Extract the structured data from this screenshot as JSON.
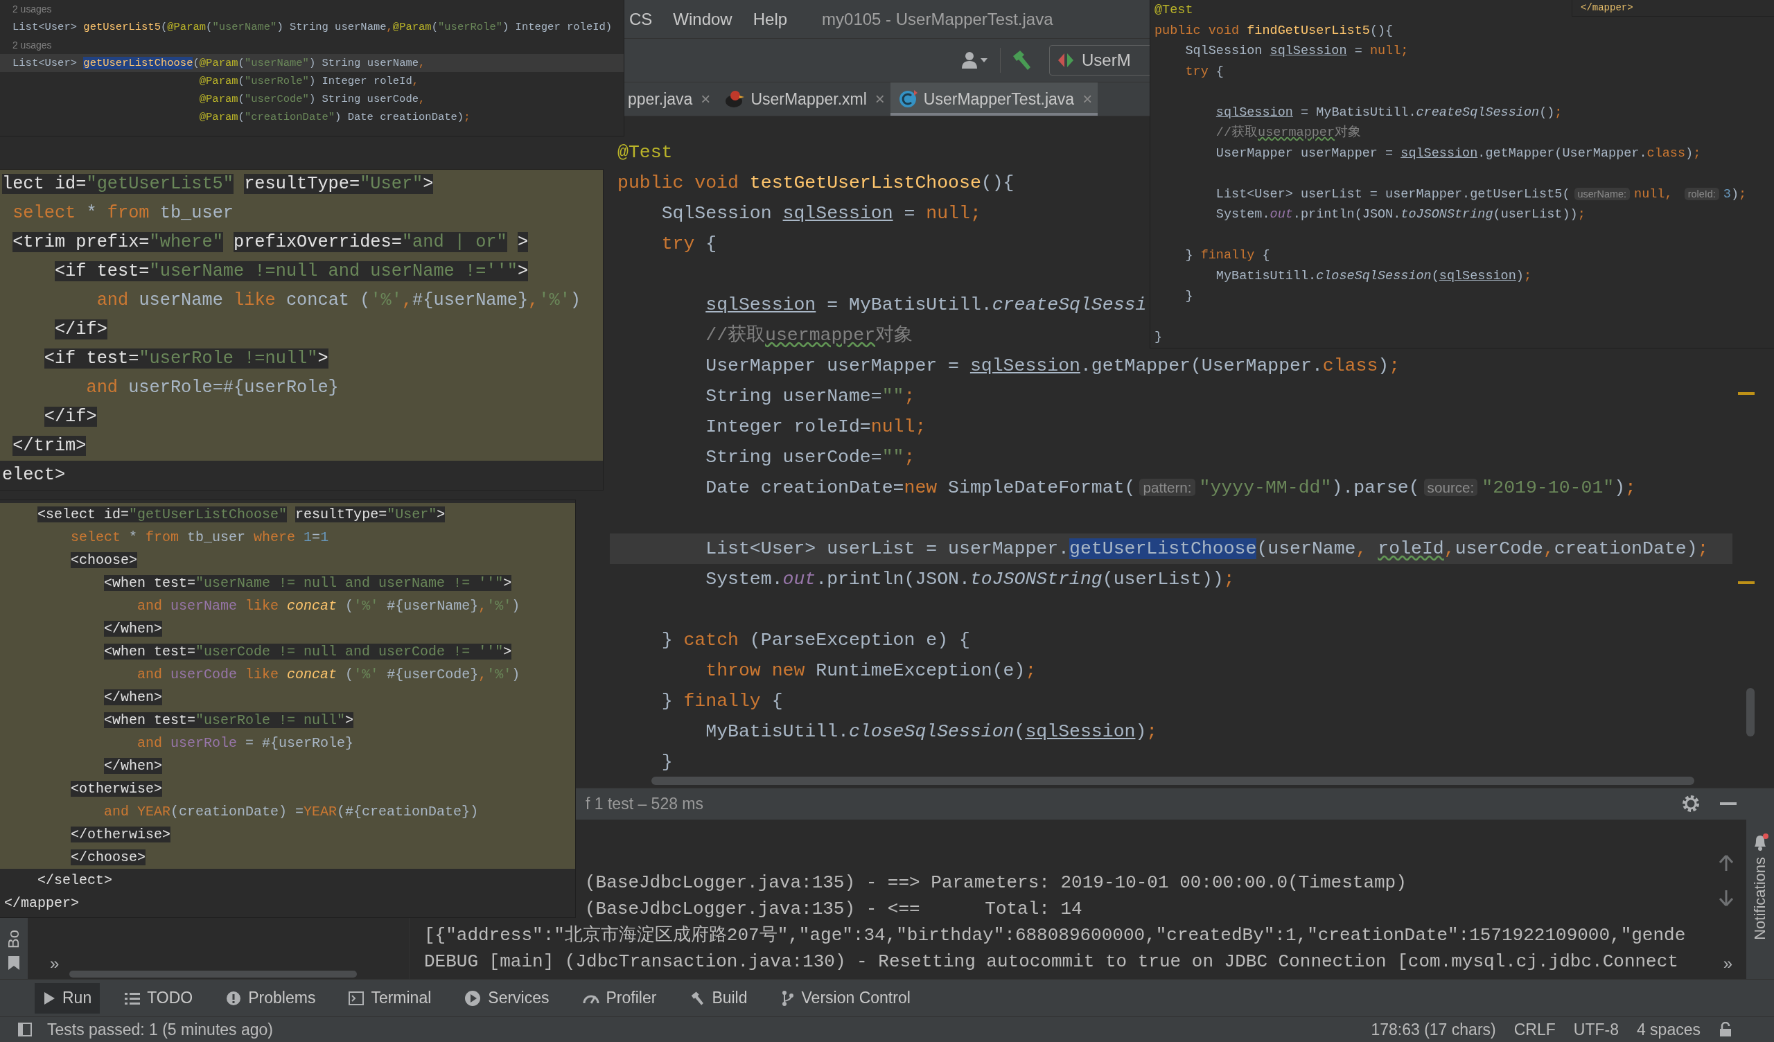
{
  "menu": [
    "CS",
    "Window",
    "Help"
  ],
  "window_title": "my0105 - UserMapperTest.java",
  "run_config": "UserM",
  "tabs": [
    {
      "label": "pper.java",
      "close": "×",
      "selected": false
    },
    {
      "label": "UserMapper.xml",
      "close": "×",
      "selected": false
    },
    {
      "label": "UserMapperTest.java",
      "close": "×",
      "selected": true
    }
  ],
  "editor": {
    "lines": [
      {
        "current": false,
        "tokens": [
          {
            "kind": "ann",
            "text": "@Test"
          }
        ]
      },
      {
        "current": false,
        "tokens": [
          {
            "kind": "kw",
            "text": "public void "
          },
          {
            "kind": "fn",
            "text": "testGetUserListChoose"
          },
          {
            "kind": "txt",
            "text": "(){"
          }
        ]
      },
      {
        "current": false,
        "tokens": [
          {
            "kind": "txt",
            "text": "    SqlSession "
          },
          {
            "kind": "ul",
            "text": "sqlSession"
          },
          {
            "kind": "txt",
            "text": " = "
          },
          {
            "kind": "kw",
            "text": "null;"
          }
        ]
      },
      {
        "current": false,
        "tokens": [
          {
            "kind": "kw",
            "text": "    try "
          },
          {
            "kind": "txt",
            "text": "{"
          }
        ]
      },
      {
        "current": false
      },
      {
        "current": false,
        "tokens": [
          {
            "kind": "ul",
            "text": "        sqlSession"
          },
          {
            "kind": "txt",
            "text": " = MyBatisUtill."
          },
          {
            "kind": "ital",
            "text": "createSqlSessi"
          }
        ]
      },
      {
        "current": false,
        "tokens": [
          {
            "kind": "cmt",
            "text": "        //获取"
          },
          {
            "kind": "typo",
            "text": "usermapper"
          },
          {
            "kind": "cmt",
            "text": "对象"
          }
        ]
      },
      {
        "current": false,
        "tokens": [
          {
            "kind": "txt",
            "text": "        UserMapper userMapper = "
          },
          {
            "kind": "ul",
            "text": "sqlSession"
          },
          {
            "kind": "txt",
            "text": ".getMapper(UserMapper."
          },
          {
            "kind": "kw",
            "text": "class"
          },
          {
            "kind": "txt",
            "text": ")"
          },
          {
            "kind": "kw",
            "text": ";"
          }
        ]
      },
      {
        "current": false,
        "tokens": [
          {
            "kind": "txt",
            "text": "        String userName="
          },
          {
            "kind": "str",
            "text": "\"\""
          },
          {
            "kind": "kw",
            "text": ";"
          }
        ]
      },
      {
        "current": false,
        "tokens": [
          {
            "kind": "txt",
            "text": "        Integer roleId="
          },
          {
            "kind": "kw",
            "text": "null;"
          }
        ]
      },
      {
        "current": false,
        "tokens": [
          {
            "kind": "txt",
            "text": "        String userCode="
          },
          {
            "kind": "str",
            "text": "\"\""
          },
          {
            "kind": "kw",
            "text": ";"
          }
        ]
      },
      {
        "current": false,
        "tokens": [
          {
            "kind": "txt",
            "text": "        Date creationDate="
          },
          {
            "kind": "kw",
            "text": "new "
          },
          {
            "kind": "txt",
            "text": "SimpleDateFormat("
          },
          {
            "kind": "hint",
            "text": "pattern:"
          },
          {
            "kind": "str",
            "text": "\"yyyy-MM-dd\""
          },
          {
            "kind": "txt",
            "text": ").parse("
          },
          {
            "kind": "hint",
            "text": "source:"
          },
          {
            "kind": "str",
            "text": "\"2019-10-01\""
          },
          {
            "kind": "txt",
            "text": ")"
          },
          {
            "kind": "kw",
            "text": ";"
          }
        ]
      },
      {
        "current": false
      },
      {
        "current": true,
        "tokens": [
          {
            "kind": "txt",
            "text": "        List<User> userList = userMapper."
          },
          {
            "kind": "sel",
            "text": "getUserListChoose"
          },
          {
            "kind": "txt",
            "text": "(userName"
          },
          {
            "kind": "kw",
            "text": ", "
          },
          {
            "kind": "wavy",
            "text": "roleId"
          },
          {
            "kind": "kw",
            "text": ","
          },
          {
            "kind": "txt",
            "text": "userCode"
          },
          {
            "kind": "kw",
            "text": ","
          },
          {
            "kind": "txt",
            "text": "creationDate)"
          },
          {
            "kind": "kw",
            "text": ";"
          }
        ]
      },
      {
        "current": false,
        "tokens": [
          {
            "kind": "txt",
            "text": "        System."
          },
          {
            "kind": "fld",
            "text": "out"
          },
          {
            "kind": "txt",
            "text": ".println(JSON."
          },
          {
            "kind": "ital",
            "text": "toJSONString"
          },
          {
            "kind": "txt",
            "text": "(userList))"
          },
          {
            "kind": "kw",
            "text": ";"
          }
        ]
      },
      {
        "current": false
      },
      {
        "current": false,
        "tokens": [
          {
            "kind": "txt",
            "text": "    } "
          },
          {
            "kind": "kw",
            "text": "catch "
          },
          {
            "kind": "txt",
            "text": "(ParseException e) {"
          }
        ]
      },
      {
        "current": false,
        "tokens": [
          {
            "kind": "kw",
            "text": "        throw new "
          },
          {
            "kind": "txt",
            "text": "RuntimeException(e)"
          },
          {
            "kind": "kw",
            "text": ";"
          }
        ]
      },
      {
        "current": false,
        "tokens": [
          {
            "kind": "txt",
            "text": "    } "
          },
          {
            "kind": "kw",
            "text": "finally "
          },
          {
            "kind": "txt",
            "text": "{"
          }
        ]
      },
      {
        "current": false,
        "tokens": [
          {
            "kind": "txt",
            "text": "        MyBatisUtill."
          },
          {
            "kind": "ital",
            "text": "closeSqlSession"
          },
          {
            "kind": "txt",
            "text": "("
          },
          {
            "kind": "ul",
            "text": "sqlSession"
          },
          {
            "kind": "txt",
            "text": ")"
          },
          {
            "kind": "kw",
            "text": ";"
          }
        ]
      },
      {
        "current": false,
        "tokens": [
          {
            "kind": "txt",
            "text": "    }"
          }
        ]
      }
    ]
  },
  "overlays": {
    "interface_snippet": {
      "lines": [
        {
          "current": false,
          "tokens": [
            {
              "kind": "gray",
              "text": "2 usages"
            }
          ]
        },
        {
          "current": false,
          "tokens": [
            {
              "kind": "txt",
              "text": "List<User> "
            },
            {
              "kind": "fn",
              "text": "getUserList5"
            },
            {
              "kind": "txt",
              "text": "("
            },
            {
              "kind": "ann",
              "text": "@Param"
            },
            {
              "kind": "txt",
              "text": "("
            },
            {
              "kind": "str",
              "text": "\"userName\""
            },
            {
              "kind": "txt",
              "text": ") String userName"
            },
            {
              "kind": "kw",
              "text": ","
            },
            {
              "kind": "ann",
              "text": "@Param"
            },
            {
              "kind": "txt",
              "text": "("
            },
            {
              "kind": "str",
              "text": "\"userRole\""
            },
            {
              "kind": "txt",
              "text": ") Integer roleId)"
            }
          ]
        },
        {
          "current": false,
          "tokens": [
            {
              "kind": "gray",
              "text": "2 usages"
            }
          ]
        },
        {
          "current": true,
          "tokens": [
            {
              "kind": "txt",
              "text": "List<User> "
            },
            {
              "kind": "selfn",
              "text": "getUserListChoose"
            },
            {
              "kind": "txt",
              "text": "("
            },
            {
              "kind": "ann",
              "text": "@Param"
            },
            {
              "kind": "txt",
              "text": "("
            },
            {
              "kind": "str",
              "text": "\"userName\""
            },
            {
              "kind": "txt",
              "text": ") String userName"
            },
            {
              "kind": "kw",
              "text": ","
            }
          ]
        },
        {
          "current": false,
          "tokens": [
            {
              "kind": "ann",
              "text": "                             @Param"
            },
            {
              "kind": "txt",
              "text": "("
            },
            {
              "kind": "str",
              "text": "\"userRole\""
            },
            {
              "kind": "txt",
              "text": ") Integer roleId"
            },
            {
              "kind": "kw",
              "text": ","
            }
          ]
        },
        {
          "current": false,
          "tokens": [
            {
              "kind": "ann",
              "text": "                             @Param"
            },
            {
              "kind": "txt",
              "text": "("
            },
            {
              "kind": "str",
              "text": "\"userCode\""
            },
            {
              "kind": "txt",
              "text": ") String userCode"
            },
            {
              "kind": "kw",
              "text": ","
            }
          ]
        },
        {
          "current": false,
          "tokens": [
            {
              "kind": "ann",
              "text": "                             @Param"
            },
            {
              "kind": "txt",
              "text": "("
            },
            {
              "kind": "str",
              "text": "\"creationDate\""
            },
            {
              "kind": "txt",
              "text": ") Date creationDate)"
            },
            {
              "kind": "kw",
              "text": ";"
            }
          ]
        }
      ]
    },
    "xml_trim": {
      "lines": [
        {
          "shaded": true,
          "tokens": [
            {
              "kind": "tag",
              "text": "lect id="
            },
            {
              "kind": "tagstr",
              "text": "\"getUserList5\""
            },
            {
              "kind": "tag",
              "text": " resultType="
            },
            {
              "kind": "tagstr",
              "text": "\"User\""
            },
            {
              "kind": "tag",
              "text": ">"
            }
          ]
        },
        {
          "shaded": true,
          "tokens": [
            {
              "kind": "kw",
              "text": " select "
            },
            {
              "kind": "txt",
              "text": "* "
            },
            {
              "kind": "kw",
              "text": "from "
            },
            {
              "kind": "txt",
              "text": "tb_user"
            }
          ]
        },
        {
          "shaded": true,
          "tokens": [
            {
              "kind": "tag",
              "text": " <trim prefix="
            },
            {
              "kind": "tagstr",
              "text": "\"where\""
            },
            {
              "kind": "tag",
              "text": " prefixOverrides="
            },
            {
              "kind": "tagstr",
              "text": "\"and | or\""
            },
            {
              "kind": "tag",
              "text": " >"
            }
          ]
        },
        {
          "shaded": true,
          "tokens": [
            {
              "kind": "tag",
              "text": "     <if test="
            },
            {
              "kind": "tagstr",
              "text": "\"userName !=null and userName !=''\""
            },
            {
              "kind": "tag",
              "text": ">"
            }
          ]
        },
        {
          "shaded": true,
          "tokens": [
            {
              "kind": "kw",
              "text": "         and "
            },
            {
              "kind": "txt",
              "text": "userName "
            },
            {
              "kind": "kw",
              "text": "like "
            },
            {
              "kind": "txt",
              "text": "concat ("
            },
            {
              "kind": "str",
              "text": "'%'"
            },
            {
              "kind": "kw",
              "text": ","
            },
            {
              "kind": "txt",
              "text": "#{userName}"
            },
            {
              "kind": "kw",
              "text": ","
            },
            {
              "kind": "str",
              "text": "'%'"
            },
            {
              "kind": "txt",
              "text": ")"
            }
          ]
        },
        {
          "shaded": true,
          "tokens": [
            {
              "kind": "tag",
              "text": "     </if>"
            }
          ]
        },
        {
          "shaded": true,
          "tokens": [
            {
              "kind": "tag",
              "text": "    <if test="
            },
            {
              "kind": "tagstr",
              "text": "\"userRole !=null\""
            },
            {
              "kind": "tag",
              "text": ">"
            }
          ]
        },
        {
          "shaded": true,
          "tokens": [
            {
              "kind": "kw",
              "text": "        and "
            },
            {
              "kind": "txt",
              "text": "userRole=#{userRole}"
            }
          ]
        },
        {
          "shaded": true,
          "tokens": [
            {
              "kind": "tag",
              "text": "    </if>"
            }
          ]
        },
        {
          "shaded": true,
          "tokens": [
            {
              "kind": "tag",
              "text": " </trim>"
            }
          ]
        },
        {
          "shaded": false,
          "tokens": [
            {
              "kind": "tag",
              "text": "elect>"
            }
          ]
        }
      ]
    },
    "xml_choose": {
      "lines": [
        {
          "shaded": true,
          "tokens": [
            {
              "kind": "tag",
              "text": "    <select id="
            },
            {
              "kind": "tagstr",
              "text": "\"getUserListChoose\""
            },
            {
              "kind": "tag",
              "text": " resultType="
            },
            {
              "kind": "tagstr",
              "text": "\"User\""
            },
            {
              "kind": "tag",
              "text": ">"
            }
          ]
        },
        {
          "shaded": true,
          "tokens": [
            {
              "kind": "kw",
              "text": "        select "
            },
            {
              "kind": "txt",
              "text": "* "
            },
            {
              "kind": "kw",
              "text": "from "
            },
            {
              "kind": "txt",
              "text": "tb_user "
            },
            {
              "kind": "kw",
              "text": "where "
            },
            {
              "kind": "num",
              "text": "1"
            },
            {
              "kind": "txt",
              "text": "="
            },
            {
              "kind": "num",
              "text": "1"
            }
          ]
        },
        {
          "shaded": true,
          "tokens": [
            {
              "kind": "tag",
              "text": "        <choose>"
            }
          ]
        },
        {
          "shaded": true,
          "tokens": [
            {
              "kind": "tag",
              "text": "            <when test="
            },
            {
              "kind": "tagstr",
              "text": "\"userName != null and userName != ''\""
            },
            {
              "kind": "tag",
              "text": ">"
            }
          ]
        },
        {
          "shaded": true,
          "tokens": [
            {
              "kind": "kw",
              "text": "                and "
            },
            {
              "kind": "var",
              "text": "userName "
            },
            {
              "kind": "kw",
              "text": "like "
            },
            {
              "kind": "fnital",
              "text": "concat "
            },
            {
              "kind": "txt",
              "text": "("
            },
            {
              "kind": "str",
              "text": "'%' "
            },
            {
              "kind": "txt",
              "text": "#{userName}"
            },
            {
              "kind": "kw",
              "text": ","
            },
            {
              "kind": "str",
              "text": "'%'"
            },
            {
              "kind": "txt",
              "text": ")"
            }
          ]
        },
        {
          "shaded": true,
          "tokens": [
            {
              "kind": "tag",
              "text": "            </when>"
            }
          ]
        },
        {
          "shaded": true,
          "tokens": [
            {
              "kind": "tag",
              "text": "            <when test="
            },
            {
              "kind": "tagstr",
              "text": "\"userCode != null and userCode != ''\""
            },
            {
              "kind": "tag",
              "text": ">"
            }
          ]
        },
        {
          "shaded": true,
          "tokens": [
            {
              "kind": "kw",
              "text": "                and "
            },
            {
              "kind": "var",
              "text": "userCode "
            },
            {
              "kind": "kw",
              "text": "like "
            },
            {
              "kind": "fnital",
              "text": "concat "
            },
            {
              "kind": "txt",
              "text": "("
            },
            {
              "kind": "str",
              "text": "'%' "
            },
            {
              "kind": "txt",
              "text": "#{userCode}"
            },
            {
              "kind": "kw",
              "text": ","
            },
            {
              "kind": "str",
              "text": "'%'"
            },
            {
              "kind": "txt",
              "text": ")"
            }
          ]
        },
        {
          "shaded": true,
          "tokens": [
            {
              "kind": "tag",
              "text": "            </when>"
            }
          ]
        },
        {
          "shaded": true,
          "tokens": [
            {
              "kind": "tag",
              "text": "            <when test="
            },
            {
              "kind": "tagstr",
              "text": "\"userRole != null\""
            },
            {
              "kind": "tag",
              "text": ">"
            }
          ]
        },
        {
          "shaded": true,
          "tokens": [
            {
              "kind": "kw",
              "text": "                and "
            },
            {
              "kind": "var",
              "text": "userRole "
            },
            {
              "kind": "txt",
              "text": "= #{userRole}"
            }
          ]
        },
        {
          "shaded": true,
          "tokens": [
            {
              "kind": "tag",
              "text": "            </when>"
            }
          ]
        },
        {
          "shaded": true,
          "tokens": [
            {
              "kind": "tag",
              "text": "        <otherwise>"
            }
          ]
        },
        {
          "shaded": true,
          "tokens": [
            {
              "kind": "kw",
              "text": "            and YEAR"
            },
            {
              "kind": "txt",
              "text": "(creationDate) ="
            },
            {
              "kind": "kw",
              "text": "YEAR"
            },
            {
              "kind": "txt",
              "text": "(#{creationDate})"
            }
          ]
        },
        {
          "shaded": true,
          "tokens": [
            {
              "kind": "tag",
              "text": "        </otherwise>"
            }
          ]
        },
        {
          "shaded": true,
          "tokens": [
            {
              "kind": "tag",
              "text": "        </choose>"
            }
          ]
        },
        {
          "shaded": false,
          "tokens": [
            {
              "kind": "tag",
              "text": "    </select>"
            }
          ]
        },
        {
          "shaded": false,
          "tokens": [
            {
              "kind": "tag",
              "text": "</mapper>"
            }
          ]
        }
      ]
    },
    "test_snippet": {
      "lines": [
        {
          "tokens": [
            {
              "kind": "ann",
              "text": "@Test"
            }
          ]
        },
        {
          "tokens": [
            {
              "kind": "kw",
              "text": "public void "
            },
            {
              "kind": "fn",
              "text": "findGetUserList5"
            },
            {
              "kind": "txt",
              "text": "(){"
            }
          ]
        },
        {
          "tokens": [
            {
              "kind": "txt",
              "text": "    SqlSession "
            },
            {
              "kind": "ul",
              "text": "sqlSession"
            },
            {
              "kind": "txt",
              "text": " = "
            },
            {
              "kind": "kw",
              "text": "null;"
            }
          ]
        },
        {
          "tokens": [
            {
              "kind": "kw",
              "text": "    try "
            },
            {
              "kind": "txt",
              "text": "{"
            }
          ]
        },
        {
          "current": false
        },
        {
          "tokens": [
            {
              "kind": "ul",
              "text": "        sqlSession"
            },
            {
              "kind": "txt",
              "text": " = MyBatisUtill."
            },
            {
              "kind": "ital",
              "text": "createSqlSession"
            },
            {
              "kind": "txt",
              "text": "()"
            },
            {
              "kind": "kw",
              "text": ";"
            }
          ]
        },
        {
          "tokens": [
            {
              "kind": "cmt",
              "text": "        //获取"
            },
            {
              "kind": "typo",
              "text": "usermapper"
            },
            {
              "kind": "cmt",
              "text": "对象"
            }
          ]
        },
        {
          "tokens": [
            {
              "kind": "txt",
              "text": "        UserMapper userMapper = "
            },
            {
              "kind": "ul",
              "text": "sqlSession"
            },
            {
              "kind": "txt",
              "text": ".getMapper(UserMapper."
            },
            {
              "kind": "kw",
              "text": "class"
            },
            {
              "kind": "txt",
              "text": ")"
            },
            {
              "kind": "kw",
              "text": ";"
            }
          ]
        },
        {
          "current": false
        },
        {
          "tokens": [
            {
              "kind": "txt",
              "text": "        List<User> userList = userMapper.getUserList5("
            },
            {
              "kind": "hint",
              "text": "userName:"
            },
            {
              "kind": "kw",
              "text": "null, "
            },
            {
              "kind": "hint",
              "text": "roleId:"
            },
            {
              "kind": "num",
              "text": "3"
            },
            {
              "kind": "txt",
              "text": ")"
            },
            {
              "kind": "kw",
              "text": ";"
            }
          ]
        },
        {
          "tokens": [
            {
              "kind": "txt",
              "text": "        System."
            },
            {
              "kind": "fld",
              "text": "out"
            },
            {
              "kind": "txt",
              "text": ".println(JSON."
            },
            {
              "kind": "ital",
              "text": "toJSONString"
            },
            {
              "kind": "txt",
              "text": "(userList))"
            },
            {
              "kind": "kw",
              "text": ";"
            }
          ]
        },
        {
          "current": false
        },
        {
          "tokens": [
            {
              "kind": "txt",
              "text": "    } "
            },
            {
              "kind": "kw",
              "text": "finally "
            },
            {
              "kind": "txt",
              "text": "{"
            }
          ]
        },
        {
          "tokens": [
            {
              "kind": "txt",
              "text": "        MyBatisUtill."
            },
            {
              "kind": "ital",
              "text": "closeSqlSession"
            },
            {
              "kind": "txt",
              "text": "("
            },
            {
              "kind": "ul",
              "text": "sqlSession"
            },
            {
              "kind": "txt",
              "text": ")"
            },
            {
              "kind": "kw",
              "text": ";"
            }
          ]
        },
        {
          "tokens": [
            {
              "kind": "txt",
              "text": "    }"
            }
          ]
        },
        {
          "current": false
        },
        {
          "tokens": [
            {
              "kind": "txt",
              "text": "}"
            }
          ]
        }
      ]
    },
    "mapper_fragment": {
      "text": "</mapper>"
    }
  },
  "run_panel": {
    "summary": "f 1 test – 528 ms",
    "console": [
      {
        "kind": "clipped",
        "text": "(BaseJdbcLogger.java:135) - ==> Parameters: 2019-10-01 00:00:00.0(Timestamp)"
      },
      {
        "kind": "clipped",
        "text": "(BaseJdbcLogger.java:135) - <==      Total: 14"
      },
      {
        "kind": "full",
        "text": "[{\"address\":\"北京市海淀区成府路207号\",\"age\":34,\"birthday\":688089600000,\"createdBy\":1,\"creationDate\":1571922109000,\"gende"
      },
      {
        "kind": "full",
        "text": "DEBUG [main] (JdbcTransaction.java:130) - Resetting autocommit to true on JDBC Connection [com.mysql.cj.jdbc.Connect"
      }
    ],
    "tree_expand": "»",
    "console_expand": "»"
  },
  "left_stripe": {
    "label": "Bo"
  },
  "notifications": "Notifications",
  "tool_windows": [
    {
      "label": "Run",
      "selected": true
    },
    {
      "label": "TODO",
      "selected": false
    },
    {
      "label": "Problems",
      "selected": false
    },
    {
      "label": "Terminal",
      "selected": false
    },
    {
      "label": "Services",
      "selected": false
    },
    {
      "label": "Profiler",
      "selected": false
    },
    {
      "label": "Build",
      "selected": false
    },
    {
      "label": "Version Control",
      "selected": false
    }
  ],
  "status_bar": {
    "message": "Tests passed: 1 (5 minutes ago)",
    "position": "178:63 (17 chars)",
    "line_separator": "CRLF",
    "encoding": "UTF-8",
    "indent": "4 spaces"
  }
}
